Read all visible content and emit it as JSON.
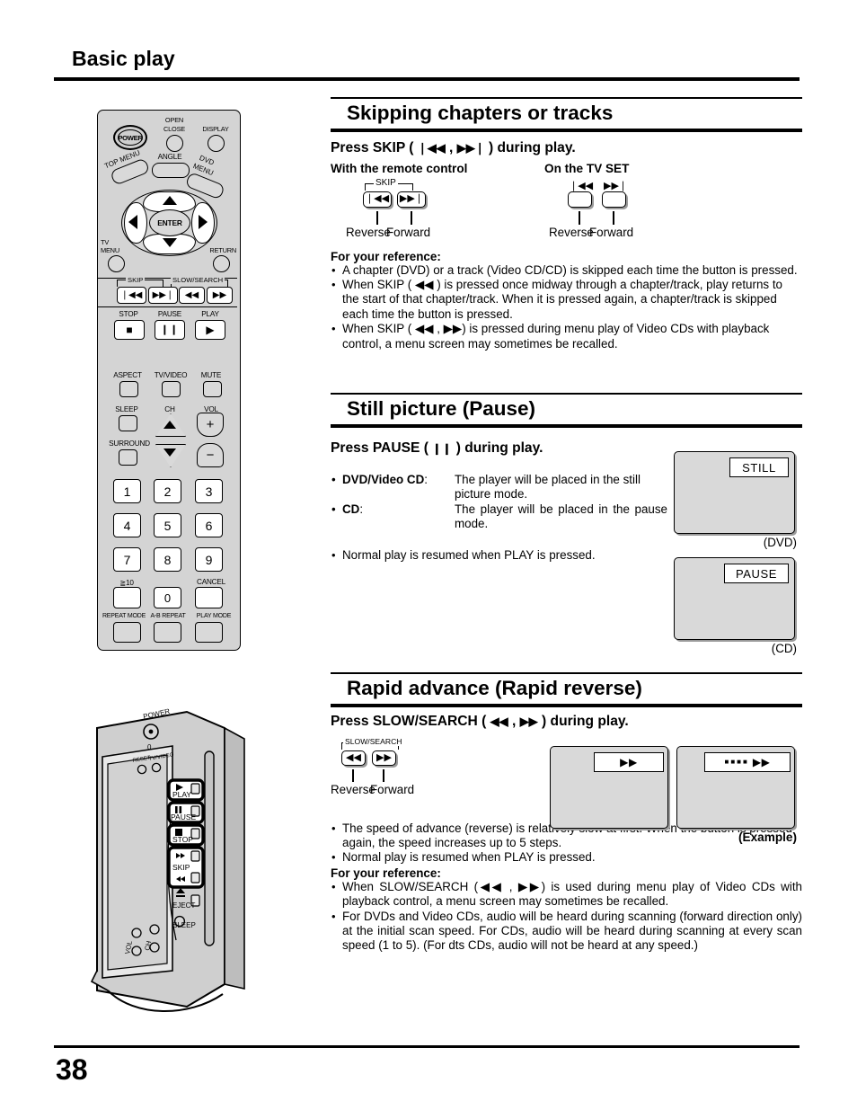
{
  "page": {
    "title": "Basic play",
    "number": "38"
  },
  "remote": {
    "name": "dvd-remote-control",
    "power_label": "POWER",
    "open_close_label_line1": "OPEN",
    "open_close_label_line2": "CLOSE",
    "display_label": "DISPLAY",
    "angle_label": "ANGLE",
    "top_menu_label": "TOP MENU",
    "dvd_menu_label_line1": "DVD",
    "dvd_menu_label_line2": "MENU",
    "enter_label": "ENTER",
    "tv_menu_label_line1": "TV",
    "tv_menu_label_line2": "MENU",
    "return_label": "RETURN",
    "skip_group_label": "SKIP",
    "slow_search_group_label": "SLOW/SEARCH",
    "stop_label": "STOP",
    "pause_label": "PAUSE",
    "play_label": "PLAY",
    "aspect_label": "ASPECT",
    "tv_video_label": "TV/VIDEO",
    "mute_label": "MUTE",
    "sleep_label": "SLEEP",
    "ch_label": "CH",
    "vol_label": "VOL",
    "surround_label": "SURROUND",
    "vol_plus": "+",
    "vol_minus": "−",
    "keys": [
      "1",
      "2",
      "3",
      "4",
      "5",
      "6",
      "7",
      "8",
      "9"
    ],
    "ten_plus_label": "≧10",
    "zero_label": "0",
    "cancel_label": "CANCEL",
    "repeat_mode_label": "REPEAT MODE",
    "ab_repeat_label": "A-B REPEAT",
    "play_mode_label": "PLAY MODE"
  },
  "tvset": {
    "name": "tv-set-front-panel",
    "power_label": "POWER",
    "power_mark": "0",
    "reset_label": "RESET",
    "tv_video_label": "TV/VIDEO",
    "play_label": "PLAY",
    "pause_label": "PAUSE",
    "stop_label": "STOP",
    "skip_label": "SKIP",
    "eject_label": "EJECT",
    "sleep_label": "SLEEP",
    "vol_label": "VOL",
    "ch_label": "CH"
  },
  "section1": {
    "heading": "Skipping chapters or tracks",
    "instruction_pre": "Press SKIP (",
    "instruction_mid": ",",
    "instruction_post": ") during play.",
    "col_remote_label": "With the remote control",
    "col_tv_label": "On the TV SET",
    "skip_bracket_label": "SKIP",
    "reverse_label": "Reverse",
    "forward_label": "Forward",
    "tv_reverse_label": "Reverse",
    "tv_forward_label": "Forward",
    "reference_title": "For your reference:",
    "bullets": [
      "A chapter (DVD) or a track (Video CD/CD) is skipped each time the button is pressed.",
      "When SKIP ( ◀◀ ) is pressed once midway through a chapter/track, play returns to the start of that chapter/track. When it is pressed again, a chapter/track is skipped each time the button is pressed.",
      "When SKIP ( ◀◀ , ▶▶) is pressed during menu play of Video CDs with playback control, a menu screen may sometimes be recalled."
    ]
  },
  "section2": {
    "heading": "Still picture (Pause)",
    "instruction_pre": "Press PAUSE (",
    "instruction_post": ") during play.",
    "items": [
      {
        "key": "DVD/Video CD",
        "key_suffix": ":",
        "value": "The player will be placed in the still picture mode."
      },
      {
        "key": "CD",
        "key_suffix": ":",
        "value": "The player will be placed in the pause mode."
      }
    ],
    "note": "Normal play is resumed when PLAY is pressed.",
    "screens": [
      {
        "osd": "STILL",
        "caption": "(DVD)"
      },
      {
        "osd": "PAUSE",
        "caption": "(CD)"
      }
    ]
  },
  "section3": {
    "heading": "Rapid advance (Rapid reverse)",
    "instruction_pre": "Press SLOW/SEARCH (",
    "instruction_mid": ",",
    "instruction_post": ") during play.",
    "slow_search_bracket_label": "SLOW/SEARCH",
    "reverse_label": "Reverse",
    "forward_label": "Forward",
    "example_caption": "(Example)",
    "bullets": [
      "The speed of advance (reverse) is relatively slow at first. When the button is pressed again, the speed increases up to 5 steps.",
      "Normal play is resumed when PLAY is pressed."
    ],
    "reference_title": "For your reference:",
    "reference_bullets": [
      "When SLOW/SEARCH (◀◀ , ▶▶) is used during menu play of Video CDs with playback control, a menu screen may sometimes be recalled.",
      "For DVDs and Video CDs, audio will be heard during scanning (forward direction only) at the initial scan speed. For CDs, audio will be heard during scanning at every scan speed (1 to 5). (For dts CDs, audio will not be heard at any speed.)"
    ]
  },
  "icons": {
    "skip_back": "❘◀◀",
    "skip_fwd": "▶▶❘",
    "rew": "◀◀",
    "ff": "▶▶",
    "play": "▶",
    "pause": "❙❙",
    "stop": "■",
    "scan_dots": "■■■■"
  },
  "colors": {
    "ink": "#000000",
    "remote_body": "#d4d4d4",
    "button_face": "#d9d9d9",
    "screen_fill": "#d9d9d9"
  }
}
